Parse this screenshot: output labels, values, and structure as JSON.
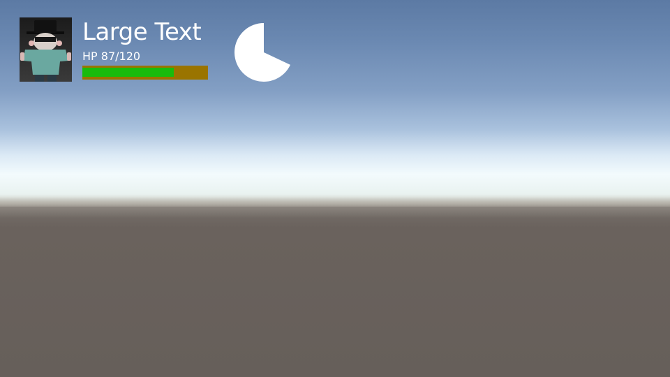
{
  "hud": {
    "title": "Large Text",
    "hp_label": "HP 87/120",
    "hp_current": 87,
    "hp_max": 120,
    "hp_fraction": 0.725,
    "cooldown_fraction": 0.68,
    "portrait_icon": "character-portrait-icon",
    "cooldown_icon": "cooldown-pie-icon"
  },
  "colors": {
    "hp_fill": "#19bb0c",
    "hp_background": "#9a7400",
    "text": "#ffffff",
    "cooldown": "#ffffff"
  }
}
